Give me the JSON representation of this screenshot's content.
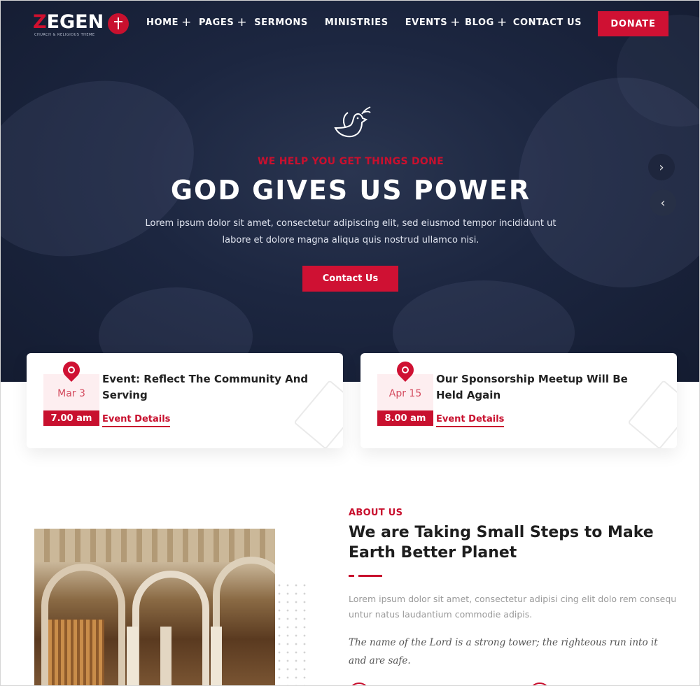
{
  "brand": {
    "name_accent": "Z",
    "name_rest": "EGEN",
    "tagline": "CHURCH & RELIGIOUS THEME"
  },
  "nav": {
    "items": [
      {
        "label": "HOME",
        "has_submenu": true
      },
      {
        "label": "PAGES",
        "has_submenu": true
      },
      {
        "label": "SERMONS",
        "has_submenu": false
      },
      {
        "label": "MINISTRIES",
        "has_submenu": false
      },
      {
        "label": "EVENTS",
        "has_submenu": true
      },
      {
        "label": "BLOG",
        "has_submenu": true
      },
      {
        "label": "CONTACT US",
        "has_submenu": false
      }
    ],
    "plus": "+",
    "donate_label": "DONATE"
  },
  "hero": {
    "tagline": "WE HELP YOU GET THINGS DONE",
    "title": "GOD GIVES US POWER",
    "description": "Lorem ipsum dolor sit amet, consectetur adipiscing elit, sed eiusmod tempor incididunt ut labore et dolore magna aliqua quis nostrud ullamco nisi.",
    "button_label": "Contact Us",
    "next_arrow": "›",
    "prev_arrow": "‹"
  },
  "events": [
    {
      "date": "Mar 3",
      "time": "7.00 am",
      "title": "Event: Reflect The Community And Serving",
      "link_label": "Event Details"
    },
    {
      "date": "Apr 15",
      "time": "8.00 am",
      "title": "Our Sponsorship Meetup Will Be Held Again",
      "link_label": "Event Details"
    }
  ],
  "about": {
    "label": "ABOUT US",
    "title": "We are Taking Small Steps to Make Earth Better Planet",
    "description": "Lorem ipsum dolor sit amet, consectetur adipisi cing elit dolo rem consequ untur natus laudantium commodie adipis.",
    "quote": "The name of the Lord is a strong tower; the righteous run into it and are safe."
  },
  "colors": {
    "accent": "#cf1133",
    "hero_bg": "#1c2640"
  }
}
